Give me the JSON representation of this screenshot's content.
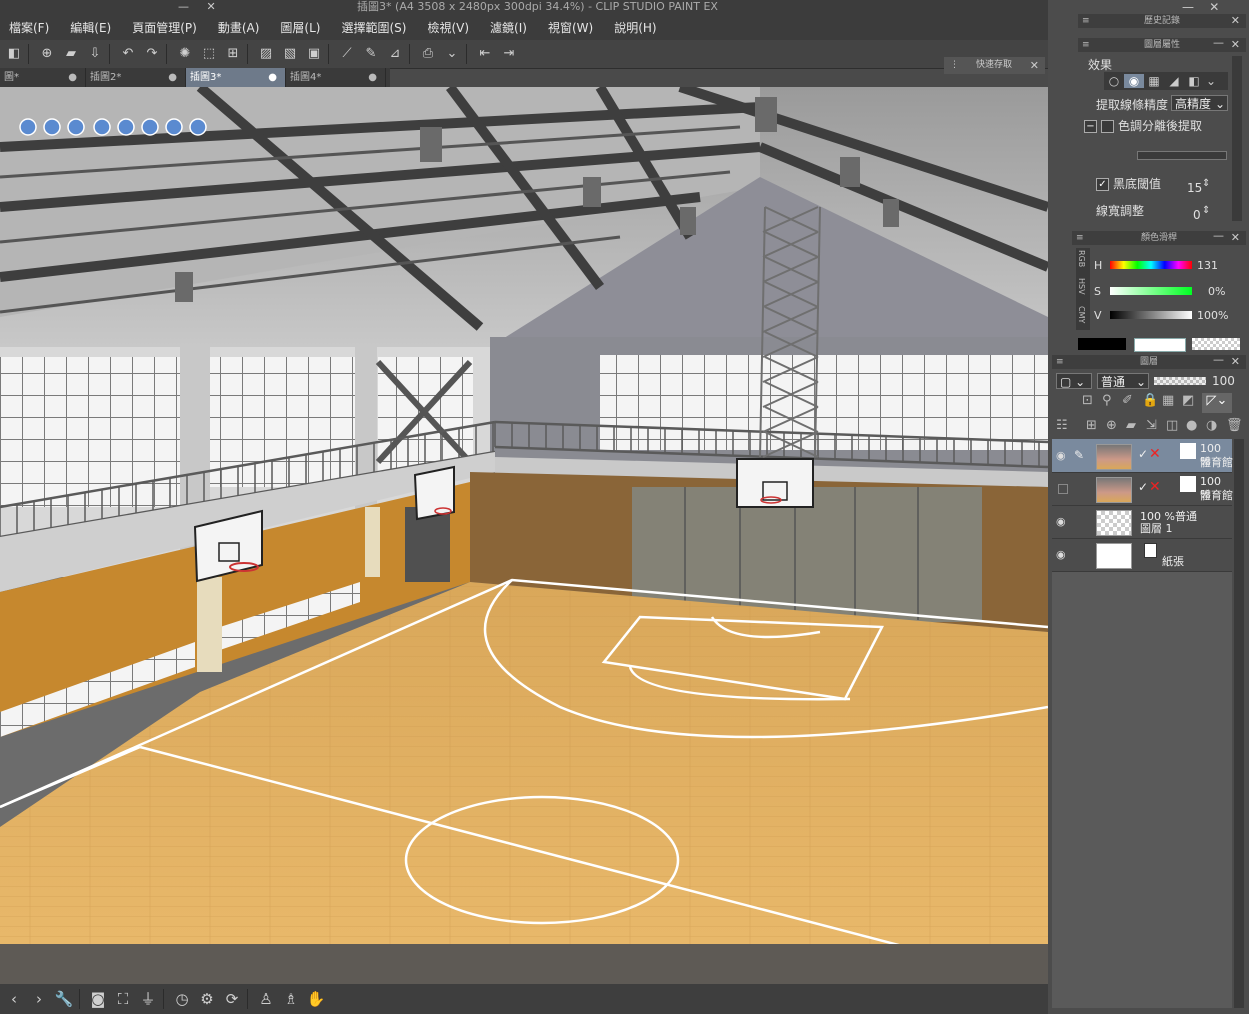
{
  "window": {
    "title": "插圖3* (A4 3508 x 2480px 300dpi 34.4%) - CLIP STUDIO PAINT EX",
    "min_btn": "—",
    "close_btn": "✕"
  },
  "menu": [
    "檔案(F)",
    "編輯(E)",
    "頁面管理(P)",
    "動畫(A)",
    "圖層(L)",
    "選擇範圍(S)",
    "檢視(V)",
    "濾鏡(I)",
    "視窗(W)",
    "說明(H)"
  ],
  "tabs": [
    {
      "label": "圖*",
      "dot": "●"
    },
    {
      "label": "插圖2*",
      "dot": "●"
    },
    {
      "label": "插圖3*",
      "dot": "●"
    },
    {
      "label": "插圖4*",
      "dot": "●"
    }
  ],
  "quick_access": {
    "title": "快速存取",
    "close": "✕"
  },
  "history_panel": {
    "title": "歷史記錄"
  },
  "layer_property_panel": {
    "title": "圖層屬性",
    "effect_label": "效果",
    "extract_precision_label": "提取線條精度",
    "extract_precision_value": "高精度",
    "tone_extract_label": "色調分離後提取",
    "black_threshold_label": "黑底閾值",
    "black_threshold_value": "15",
    "line_width_label": "線寬調整",
    "line_width_value": "0"
  },
  "color_panel": {
    "title": "顏色滑桿",
    "side_tabs": [
      "RGB",
      "HSV",
      "CMY"
    ],
    "h_label": "H",
    "h_value": "131",
    "s_label": "S",
    "s_value": "0%",
    "s_level": 0,
    "v_label": "V",
    "v_value": "100%",
    "v_level": 100
  },
  "layers_panel": {
    "title": "圖層",
    "blend_mode": "普通",
    "opacity": "100",
    "layers": [
      {
        "pct": "100 %",
        "name": "體育館",
        "selected": true
      },
      {
        "pct": "100 %",
        "name": "體育館",
        "selected": false
      },
      {
        "pct": "100 %普通",
        "name": "圖層 1",
        "selected": false
      },
      {
        "pct": "",
        "name": "紙張",
        "selected": false
      }
    ]
  },
  "colors": {
    "accent": "#7a8a9e",
    "bg": "#4a4a4a"
  }
}
